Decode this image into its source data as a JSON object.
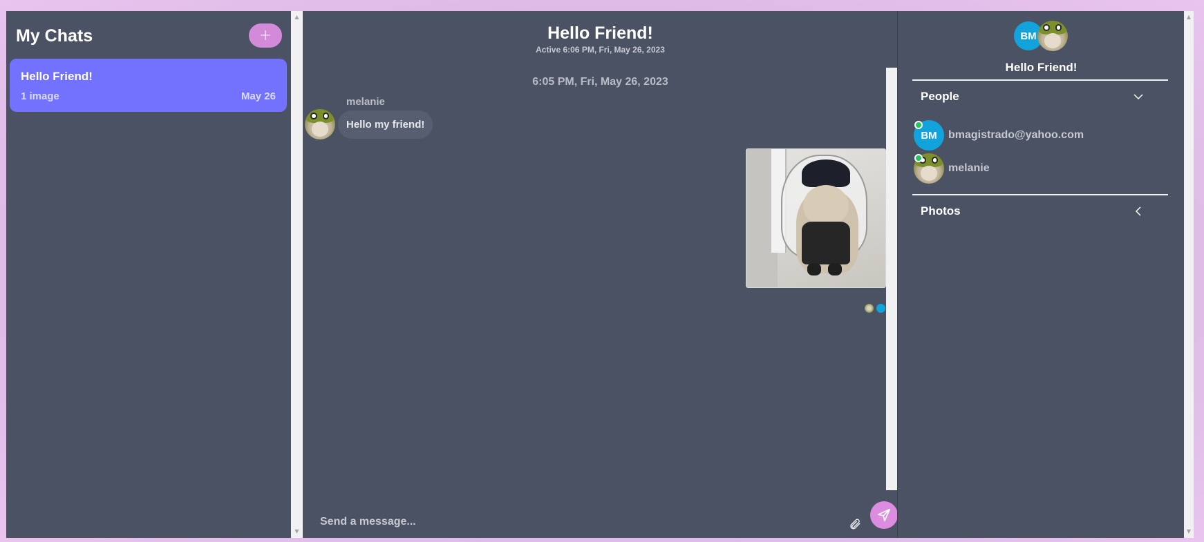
{
  "sidebar": {
    "title": "My Chats",
    "new_chat_label": "+",
    "chats": [
      {
        "title": "Hello Friend!",
        "subtitle": "1 image",
        "date": "May 26"
      }
    ]
  },
  "chat": {
    "title": "Hello Friend!",
    "active": "Active 6:06 PM, Fri, May 26, 2023",
    "timestamp": "6:05 PM, Fri, May 26, 2023",
    "messages": [
      {
        "sender": "melanie",
        "text": "Hello my friend!"
      }
    ],
    "composer_placeholder": "Send a message..."
  },
  "details": {
    "title": "Hello Friend!",
    "group_avatar_initials": "BM",
    "people_label": "People",
    "people": [
      {
        "name": "bmagistrado@yahoo.com",
        "initials": "BM",
        "online": true
      },
      {
        "name": "melanie",
        "initials": "",
        "online": true
      }
    ],
    "photos_label": "Photos"
  },
  "colors": {
    "background": "#4b5263",
    "accent_pink": "#d38ad9",
    "chat_card": "#7272ff",
    "bm_blue": "#12a3dc",
    "online_green": "#22c55e"
  }
}
